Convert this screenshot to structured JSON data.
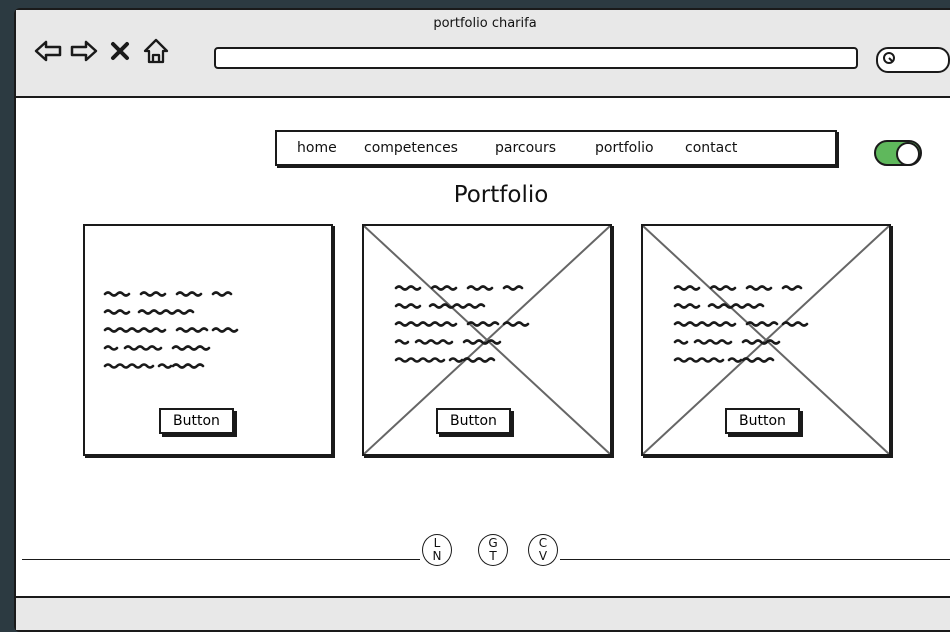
{
  "window": {
    "title": "portfolio charifa"
  },
  "nav": {
    "items": [
      "home",
      "competences",
      "parcours",
      "portfolio",
      "contact"
    ]
  },
  "page": {
    "title": "Portfolio"
  },
  "cards": [
    {
      "button": "Button",
      "has_image_placeholder": false
    },
    {
      "button": "Button",
      "has_image_placeholder": true
    },
    {
      "button": "Button",
      "has_image_placeholder": true
    }
  ],
  "footer": {
    "circles": [
      {
        "top": "L",
        "bottom": "N"
      },
      {
        "top": "G",
        "bottom": "T"
      },
      {
        "top": "C",
        "bottom": "V"
      }
    ]
  },
  "toggle": {
    "state": "on",
    "color": "#5fb85c"
  },
  "icons": [
    "back-arrow-icon",
    "forward-arrow-icon",
    "stop-icon",
    "home-icon",
    "search-icon"
  ]
}
